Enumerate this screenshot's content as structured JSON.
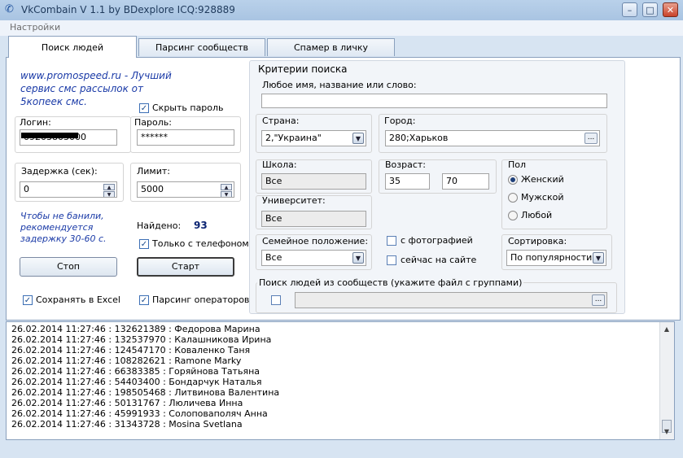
{
  "window": {
    "title": "VkCombain V 1.1 by BDexplore ICQ:928889",
    "minimize": "–",
    "maximize": "□",
    "close": "✕"
  },
  "menu": {
    "settings": "Настройки"
  },
  "tabs": [
    "Поиск людей",
    "Парсинг сообществ",
    "Спамер в личку"
  ],
  "left": {
    "promo": "www.promospeed.ru - Лучший сервис смс рассылок от 5копеек смс.",
    "hide_password": "Скрыть пароль",
    "login_label": "Логин:",
    "login_value": "09203803000",
    "password_label": "Пароль:",
    "password_value": "******",
    "delay_label": "Задержка (сек):",
    "delay_value": "0",
    "limit_label": "Лимит:",
    "limit_value": "5000",
    "hint": "Чтобы не банили, рекомендуется задержку 30-60 с.",
    "found_label": "Найдено:",
    "found_value": "93",
    "only_phone": "Только с телефоном",
    "stop": "Стоп",
    "start": "Старт",
    "save_excel": "Сохранять в Excel",
    "parse_operators": "Парсинг операторов"
  },
  "criteria": {
    "title": "Критерии поиска",
    "any_name_label": "Любое имя, название или слово:",
    "any_name_value": "",
    "country_label": "Страна:",
    "country_value": "2,\"Украина\"",
    "city_label": "Город:",
    "city_value": "280;Харьков",
    "school_label": "Школа:",
    "school_value": "Все",
    "age_label": "Возраст:",
    "age_from": "35",
    "age_to": "70",
    "gender_label": "Пол",
    "gender_options": [
      "Женский",
      "Мужской",
      "Любой"
    ],
    "university_label": "Университет:",
    "university_value": "Все",
    "marital_label": "Семейное положение:",
    "marital_value": "Все",
    "with_photo": "с фотографией",
    "online_now": "сейчас на сайте",
    "sort_label": "Сортировка:",
    "sort_value": "По популярности",
    "groups_label": "Поиск людей из сообществ (укажите файл с группами)",
    "groups_value": ""
  },
  "log": [
    "26.02.2014 11:27:46 : 132621389 : Федорова Марина",
    "26.02.2014 11:27:46 : 132537970 : Калашникова Ирина",
    "26.02.2014 11:27:46 : 124547170 : Коваленко Таня",
    "26.02.2014 11:27:46 : 108282621 : Ramone Marky",
    "26.02.2014 11:27:46 : 66383385 : Горяйнова Татьяна",
    "26.02.2014 11:27:46 : 54403400 : Бондарчук Наталья",
    "26.02.2014 11:27:46 : 198505468 : Литвинова Валентина",
    "26.02.2014 11:27:46 : 50131767 : Люличева Инна",
    "26.02.2014 11:27:46 : 45991933 : Солоповаполяч Анна",
    "26.02.2014 11:27:46 : 31343728 : Mosina Svetlana"
  ]
}
